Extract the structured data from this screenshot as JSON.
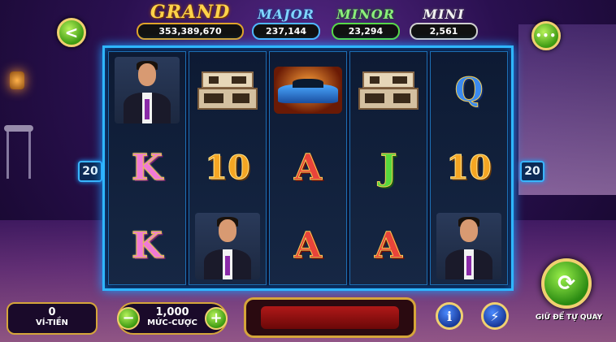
{
  "jackpots": {
    "grand": {
      "label": "GRAND",
      "value": "353,389,670"
    },
    "major": {
      "label": "MAJOR",
      "value": "237,144"
    },
    "minor": {
      "label": "MINOR",
      "value": "23,294"
    },
    "mini": {
      "label": "MINI",
      "value": "2,561"
    }
  },
  "nav": {
    "back_icon": "chevron-left-icon",
    "menu_icon": "more-dots-icon",
    "back_glyph": "<",
    "menu_glyph": "•••"
  },
  "paylines": {
    "left": "20",
    "right": "20"
  },
  "reels": [
    [
      "man",
      "K",
      "K"
    ],
    [
      "house",
      "10",
      "man"
    ],
    [
      "car",
      "A",
      "A"
    ],
    [
      "house",
      "J",
      "A"
    ],
    [
      "Q",
      "10",
      "man"
    ]
  ],
  "bottom": {
    "wallet": {
      "value": "0",
      "label": "VÍ-TIỀN"
    },
    "bet": {
      "value": "1,000",
      "label": "MỨC-CƯỢC",
      "minus": "−",
      "plus": "+"
    },
    "info_glyph": "i",
    "bolt_glyph": "⚡",
    "auto_glyph": "⟳",
    "auto_label": "GIỮ ĐỂ TỰ QUAY"
  },
  "colors": {
    "reel_border": "#2fb6ff",
    "gold": "#d5a53a",
    "button_green": "#3c9a12"
  }
}
